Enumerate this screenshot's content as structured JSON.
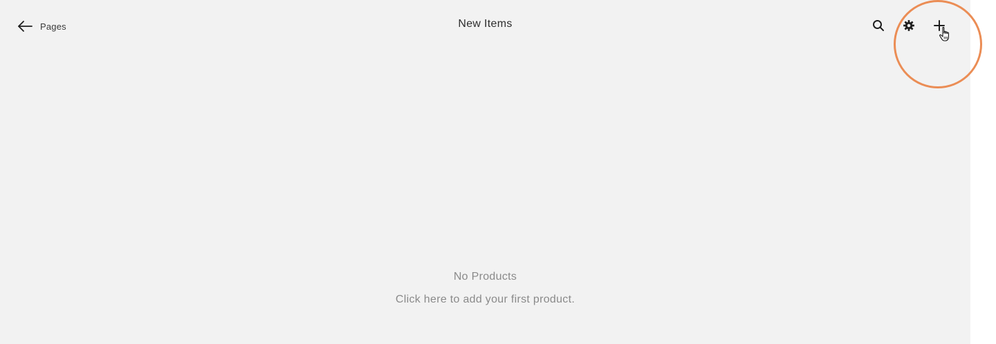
{
  "header": {
    "back_label": "Pages",
    "title": "New Items",
    "icons": {
      "back": "arrow-left-icon",
      "search": "search-icon",
      "settings": "gear-icon",
      "add": "plus-icon"
    }
  },
  "empty_state": {
    "title": "No Products",
    "subtitle": "Click here to add your first product."
  },
  "colors": {
    "panel_background": "#f2f2f2",
    "highlight": "#eb8d55",
    "text_primary": "#2d2d2d",
    "text_muted": "#8a8a8a"
  }
}
